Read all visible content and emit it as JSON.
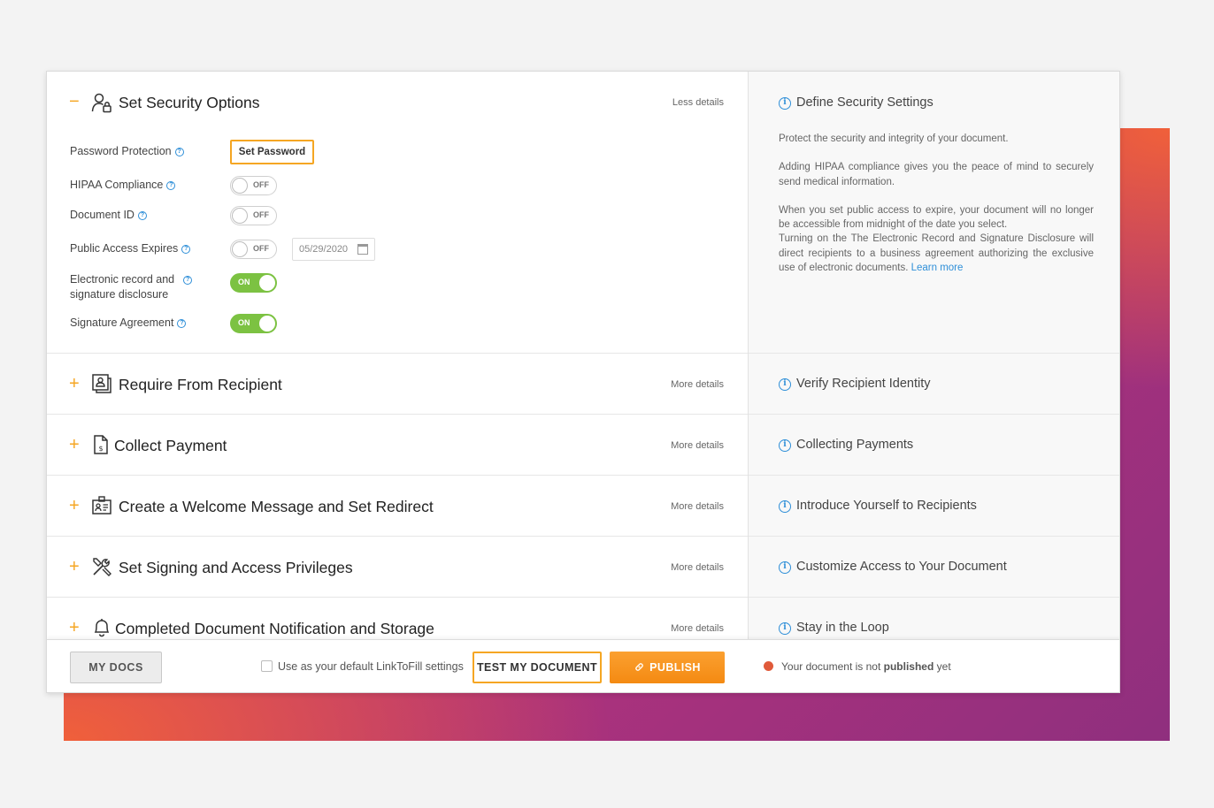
{
  "sections": [
    {
      "sign": "−",
      "title": "Set Security Options",
      "details": "Less details",
      "info_title": "Define Security Settings",
      "icon": "user-lock-icon"
    },
    {
      "sign": "+",
      "title": "Require From Recipient",
      "details": "More details",
      "info_title": "Verify Recipient Identity",
      "icon": "id-card-icon"
    },
    {
      "sign": "+",
      "title": "Collect Payment",
      "details": "More details",
      "info_title": "Collecting Payments",
      "icon": "payment-doc-icon"
    },
    {
      "sign": "+",
      "title": "Create a Welcome Message and Set Redirect",
      "details": "More details",
      "info_title": "Introduce Yourself to Recipients",
      "icon": "badge-icon"
    },
    {
      "sign": "+",
      "title": "Set Signing and Access Privileges",
      "details": "More details",
      "info_title": "Customize Access to Your Document",
      "icon": "tools-icon"
    },
    {
      "sign": "+",
      "title": "Completed Document Notification and Storage",
      "details": "More details",
      "info_title": "Stay in the Loop",
      "icon": "bell-icon"
    }
  ],
  "security": {
    "password_label": "Password Protection",
    "set_password": "Set Password",
    "hipaa_label": "HIPAA Compliance",
    "hipaa_state": "OFF",
    "docid_label": "Document ID",
    "docid_state": "OFF",
    "expires_label": "Public Access Expires",
    "expires_state": "OFF",
    "expires_date": "05/29/2020",
    "erecord_label_1": "Electronic record and",
    "erecord_label_2": "signature disclosure",
    "erecord_state": "ON",
    "agreement_label": "Signature Agreement",
    "agreement_state": "ON"
  },
  "security_info": {
    "p1": "Protect the security and integrity of your document.",
    "p2": "Adding HIPAA compliance gives you the peace of mind to securely send medical information.",
    "p3": "When you set public access to expire, your document will no longer be accessible from midnight of the date you select.",
    "p4": "Turning on the The Electronic Record and Signature Disclosure will direct recipients to a business agreement authorizing the exclusive use of electronic documents.",
    "learn_more": "Learn more"
  },
  "footer": {
    "my_docs": "MY DOCS",
    "default_label": "Use as your default LinkToFill settings",
    "test": "TEST MY DOCUMENT",
    "publish": "PUBLISH",
    "status_pre": "Your document is not",
    "status_bold": "published",
    "status_post": "yet"
  },
  "colors": {
    "accent": "#f5a623",
    "on": "#7cc242",
    "info": "#2f8fd8",
    "status": "#e05a3a"
  }
}
